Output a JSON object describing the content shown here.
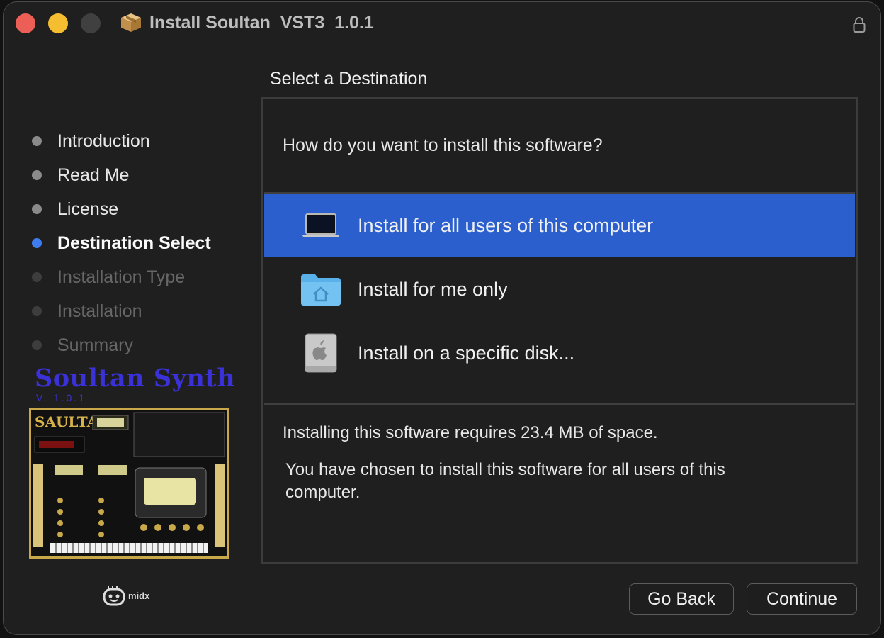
{
  "window": {
    "title": "Install Soultan_VST3_1.0.1"
  },
  "heading": "Select a Destination",
  "steps": [
    {
      "label": "Introduction",
      "state": "done"
    },
    {
      "label": "Read Me",
      "state": "done"
    },
    {
      "label": "License",
      "state": "done"
    },
    {
      "label": "Destination Select",
      "state": "current"
    },
    {
      "label": "Installation Type",
      "state": "todo"
    },
    {
      "label": "Installation",
      "state": "todo"
    },
    {
      "label": "Summary",
      "state": "todo"
    }
  ],
  "brand": {
    "name": "Soultan Synth",
    "version": "V. 1.0.1",
    "product_name": "SAULTAN",
    "vendor": "midx"
  },
  "panel": {
    "question": "How do you want to install this software?",
    "options": [
      {
        "label": "Install for all users of this computer",
        "icon": "laptop-icon",
        "selected": true
      },
      {
        "label": "Install for me only",
        "icon": "home-folder-icon",
        "selected": false
      },
      {
        "label": "Install on a specific disk...",
        "icon": "disk-icon",
        "selected": false
      }
    ],
    "space_required": "Installing this software requires 23.4 MB of space.",
    "chosen_message": "You have chosen to install this software for all users of this computer."
  },
  "buttons": {
    "back": "Go Back",
    "continue": "Continue"
  },
  "colors": {
    "accent": "#2b5fcd",
    "brand": "#3a32d8"
  }
}
